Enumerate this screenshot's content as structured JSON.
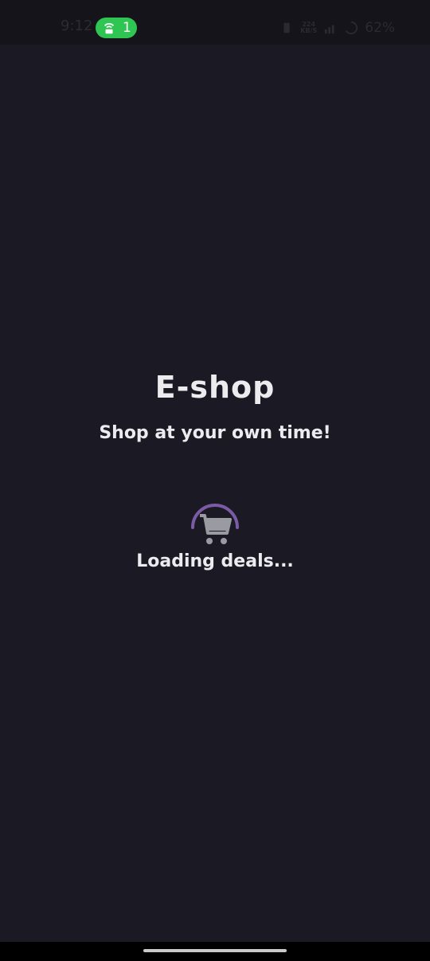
{
  "status_bar": {
    "time": "9:12",
    "hotspot_count": "1",
    "data_speed_top": "224",
    "data_speed_bottom": "KB/S",
    "battery": "62%"
  },
  "app": {
    "title": "E-shop",
    "tagline": "Shop at your own time!",
    "loading_text": "Loading deals..."
  },
  "colors": {
    "background": "#1b1924",
    "spinner_arc": "#7b5aa6",
    "hotspot_pill": "#2fc552",
    "text": "#ececef"
  },
  "icons": {
    "loader": "cart-icon",
    "hotspot": "hotspot-icon"
  }
}
